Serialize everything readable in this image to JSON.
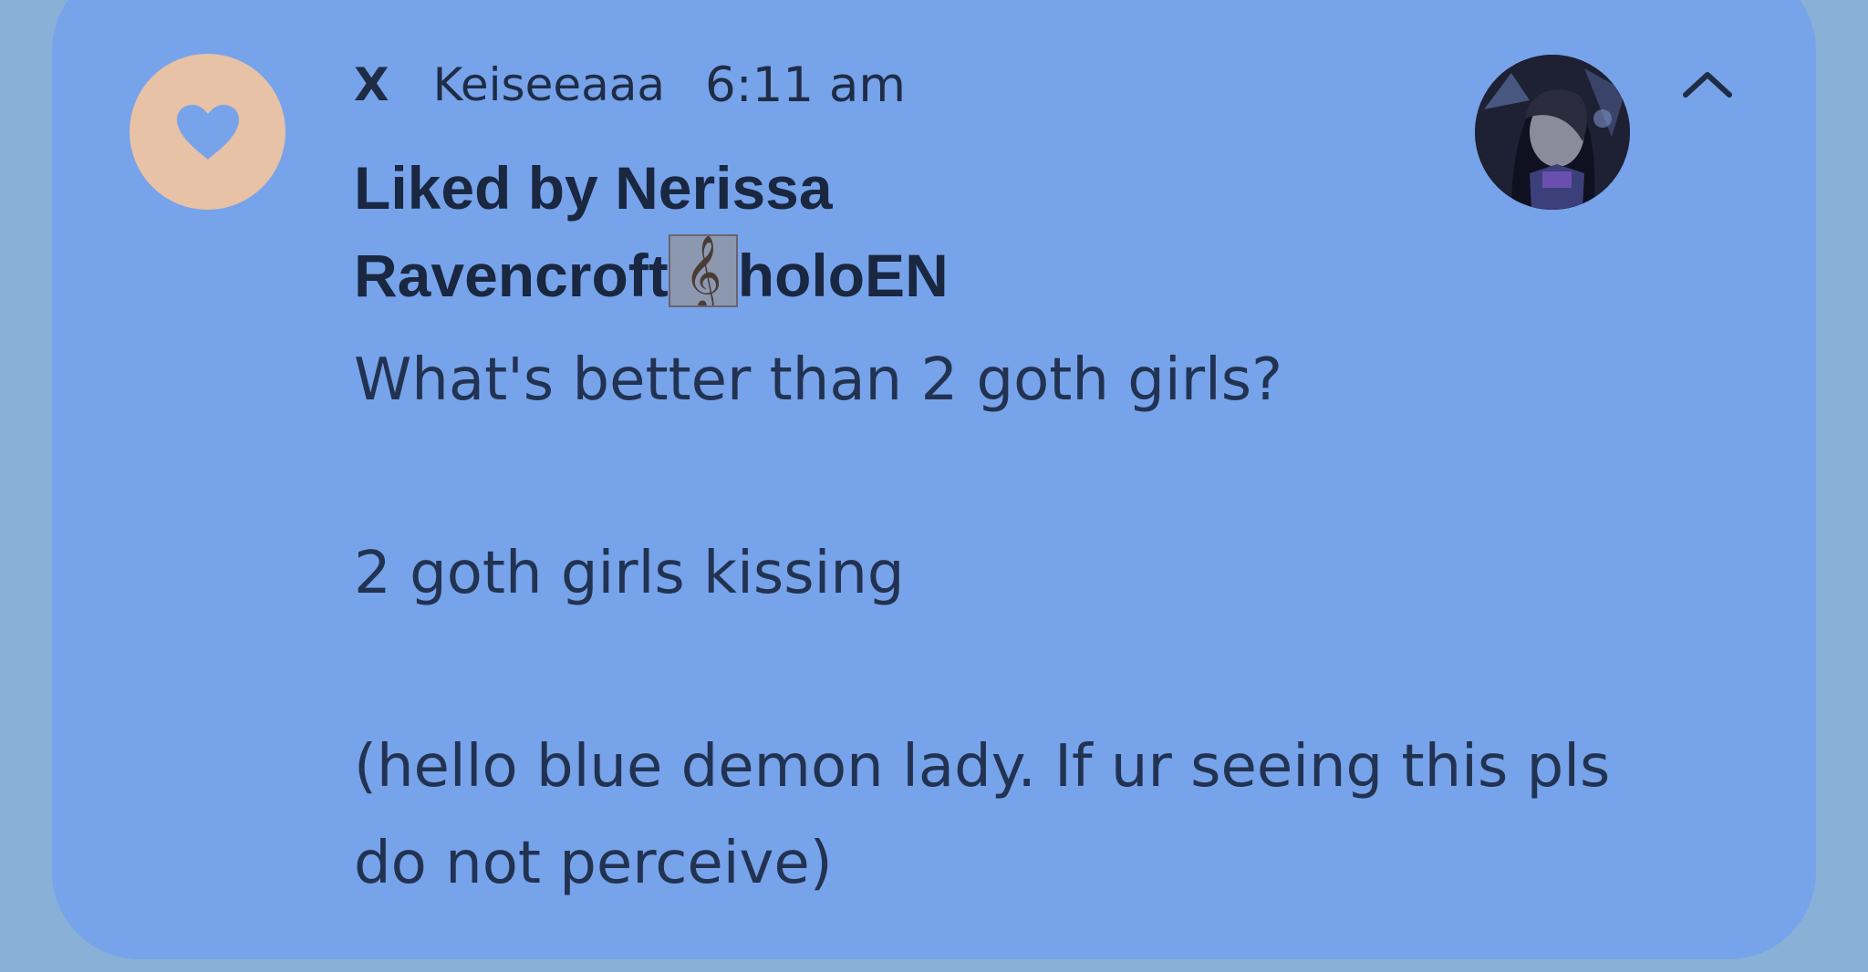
{
  "notification": {
    "app_name": "X",
    "account": "Keiseeaaa",
    "time": "6:11 am",
    "title_prefix": "Liked by Nerissa Ravencroft",
    "title_emoji": "𝄞",
    "title_suffix": "holoEN",
    "body_lines": [
      "What's better than 2 goth girls?",
      "",
      "2 goth girls kissing",
      "",
      "(hello blue demon lady. If ur seeing this pls do not perceive)"
    ]
  },
  "icons": {
    "app": "heart-icon",
    "avatar": "profile-avatar",
    "expand": "chevron-up-icon"
  },
  "colors": {
    "background": "#89b0d6",
    "card": "#77a3ea",
    "app_icon_circle": "#e8c2a6",
    "heart": "#77a3ea",
    "text": "#1f2c45"
  }
}
